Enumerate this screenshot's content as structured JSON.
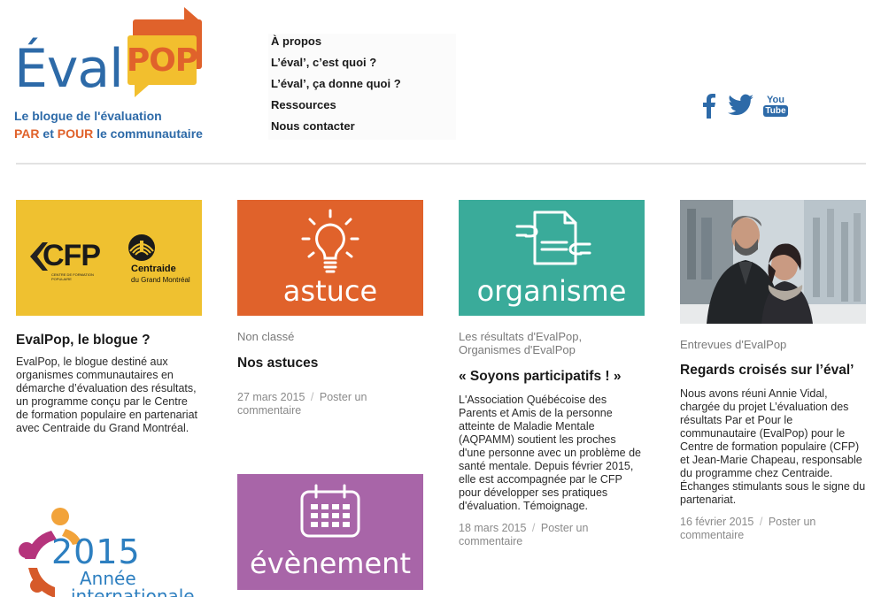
{
  "header": {
    "logo_word": "Éval",
    "logo_pop": "POP",
    "tagline_1": "Le blogue de l'évaluation",
    "tagline_2_a": "PAR",
    "tagline_2_b": " et ",
    "tagline_2_c": "POUR",
    "tagline_2_d": " le communautaire"
  },
  "nav": [
    "À propos",
    "L’éval’, c’est quoi ?",
    "L’éval’, ça donne quoi ?",
    "Ressources",
    "Nous contacter"
  ],
  "social": [
    "facebook-icon",
    "twitter-icon",
    "youtube-icon"
  ],
  "social_youtube_top": "You",
  "social_youtube_bottom": "Tube",
  "posts": [
    {
      "title": "EvalPop, le blogue ?",
      "excerpt": "EvalPop, le blogue destiné aux organismes communautaires en démarche d’évaluation des résultats, un programme conçu par le Centre de formation populaire en partenariat avec Centraide du Grand Montréal.",
      "thumb": {
        "bg": "#efc130",
        "cfp_logo": "CFP",
        "cfp_sub": "CENTRE DE FORMATION POPULAIRE",
        "centraide_name": "Centraide",
        "centraide_sub": "du Grand Montréal"
      }
    },
    {
      "category": "Non classé",
      "title": "Nos astuces",
      "date": "27 mars 2015",
      "comment": "Poster un commentaire",
      "thumb": {
        "bg": "#e0622b",
        "label": "astuce",
        "icon": "lightbulb-icon"
      }
    },
    {
      "category": "Les résultats d'EvalPop, Organismes d'EvalPop",
      "title": "« Soyons participatifs ! »",
      "excerpt": "L'Association Québécoise des Parents et Amis de la personne atteinte de Maladie Mentale (AQPAMM) soutient les proches d'une personne avec un problème de santé mentale. Depuis février 2015, elle est accompagnée par le CFP pour développer ses pratiques d'évaluation. Témoignage.",
      "date": "18 mars 2015",
      "comment": "Poster un commentaire",
      "thumb": {
        "bg": "#3aab9a",
        "label": "organisme",
        "icon": "document-hands-icon"
      }
    },
    {
      "category": "Entrevues d'EvalPop",
      "title": "Regards croisés sur l’éval’",
      "excerpt": "Nous avons réuni Annie Vidal, chargée du projet L’évaluation des résultats Par et Pour le communautaire (EvalPop) pour le Centre de formation populaire (CFP) et Jean-Marie Chapeau, responsable du programme chez Centraide. Échanges stimulants sous le signe du partenariat.",
      "date": "16 février 2015",
      "comment": "Poster un commentaire",
      "thumb": {
        "kind": "photo",
        "icon": "photo-two-people"
      }
    },
    {
      "thumb": {
        "bg": "#a865a8",
        "label": "évènement",
        "icon": "calendar-icon"
      }
    }
  ],
  "year_logo": {
    "year": "2015",
    "line1": "Année",
    "line2": "internationale"
  },
  "separator": "/",
  "colors": {
    "brand_blue": "#2d6aa8",
    "brand_orange": "#e0622b",
    "brand_yellow": "#f2bf2e",
    "teal": "#3aab9a",
    "purple": "#a865a8"
  }
}
